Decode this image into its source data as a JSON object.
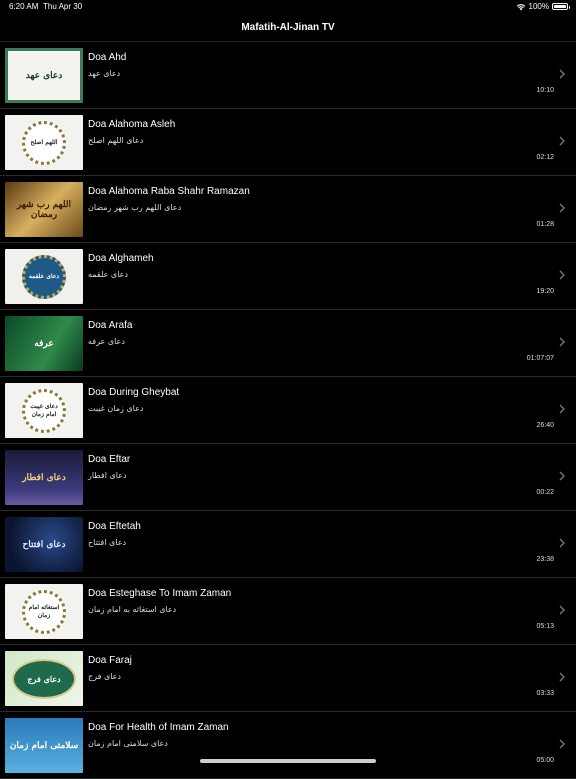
{
  "status": {
    "time": "6:20 AM",
    "date": "Thu Apr 30",
    "battery": "100%"
  },
  "nav": {
    "title": "Mafatih-Al-Jinan TV"
  },
  "items": [
    {
      "title": "Doa Ahd",
      "subtitle": "دعای عهد",
      "duration": "10:10",
      "thumb_text": "دعای عهد",
      "thumb_style": "frame-white"
    },
    {
      "title": "Doa Alahoma Asleh",
      "subtitle": "دعای اللهم اصلح",
      "duration": "02:12",
      "thumb_text": "اللهم اصلح",
      "thumb_style": "circle-white"
    },
    {
      "title": "Doa Alahoma Raba Shahr Ramazan",
      "subtitle": "دعای اللهم رب شهر رمضان",
      "duration": "01:28",
      "thumb_text": "اللهم رب شهر رمضان",
      "thumb_style": "gold"
    },
    {
      "title": "Doa Alghameh",
      "subtitle": "دعای علقمه",
      "duration": "19:20",
      "thumb_text": "دعای علقمه",
      "thumb_style": "circle-blue"
    },
    {
      "title": "Doa Arafa",
      "subtitle": "دعای عرفه",
      "duration": "01:07:07",
      "thumb_text": "عرفه",
      "thumb_style": "green"
    },
    {
      "title": "Doa During Gheybat",
      "subtitle": "دعای زمان غیبت",
      "duration": "26:40",
      "thumb_text": "دعای غیبت امام زمان",
      "thumb_style": "circle-white"
    },
    {
      "title": "Doa Eftar",
      "subtitle": "دعای افطار",
      "duration": "00:22",
      "thumb_text": "دعای افطار",
      "thumb_style": "night-purple"
    },
    {
      "title": "Doa Eftetah",
      "subtitle": "دعای افتتاح",
      "duration": "23:38",
      "thumb_text": "دعای افتتاح",
      "thumb_style": "night-blue"
    },
    {
      "title": "Doa Esteghase To Imam Zaman",
      "subtitle": "دعای استغاثه به امام زمان",
      "duration": "05:13",
      "thumb_text": "استغاثه امام زمان",
      "thumb_style": "circle-white"
    },
    {
      "title": "Doa Faraj",
      "subtitle": "دعای فرج",
      "duration": "03:33",
      "thumb_text": "دعای فرج",
      "thumb_style": "green-oval"
    },
    {
      "title": "Doa For Health of Imam Zaman",
      "subtitle": "دعای سلامتی امام زمان",
      "duration": "05:00",
      "thumb_text": "سلامتی امام زمان",
      "thumb_style": "blue-tile"
    }
  ],
  "icons": {
    "chevron": "chevron-right-icon",
    "wifi": "wifi-icon",
    "battery": "battery-icon"
  },
  "colors": {
    "background": "#000000",
    "text": "#ffffff",
    "subtext": "#dddddd",
    "separator": "#2a2a2a"
  }
}
